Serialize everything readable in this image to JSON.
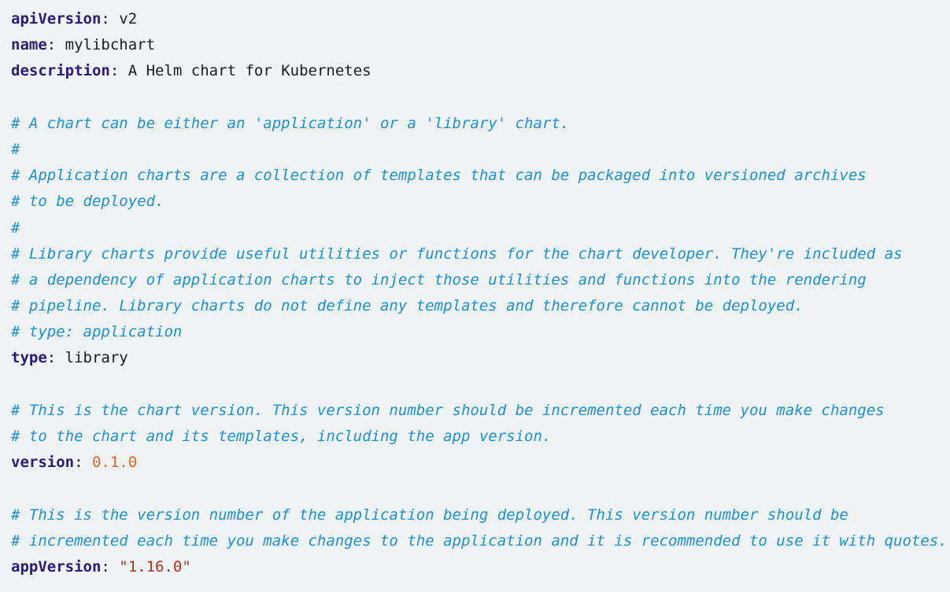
{
  "lines": [
    {
      "kind": "kv",
      "key": "apiVersion",
      "sep": ": ",
      "value": "v2",
      "vtype": "plain"
    },
    {
      "kind": "kv",
      "key": "name",
      "sep": ": ",
      "value": "mylibchart",
      "vtype": "plain"
    },
    {
      "kind": "kv",
      "key": "description",
      "sep": ": ",
      "value": "A Helm chart for Kubernetes",
      "vtype": "plain"
    },
    {
      "kind": "blank"
    },
    {
      "kind": "comment",
      "text": "# A chart can be either an 'application' or a 'library' chart."
    },
    {
      "kind": "comment",
      "text": "#"
    },
    {
      "kind": "comment",
      "text": "# Application charts are a collection of templates that can be packaged into versioned archives"
    },
    {
      "kind": "comment",
      "text": "# to be deployed."
    },
    {
      "kind": "comment",
      "text": "#"
    },
    {
      "kind": "comment",
      "text": "# Library charts provide useful utilities or functions for the chart developer. They're included as"
    },
    {
      "kind": "comment",
      "text": "# a dependency of application charts to inject those utilities and functions into the rendering"
    },
    {
      "kind": "comment",
      "text": "# pipeline. Library charts do not define any templates and therefore cannot be deployed."
    },
    {
      "kind": "comment",
      "text": "# type: application"
    },
    {
      "kind": "kv",
      "key": "type",
      "sep": ": ",
      "value": "library",
      "vtype": "plain"
    },
    {
      "kind": "blank"
    },
    {
      "kind": "comment",
      "text": "# This is the chart version. This version number should be incremented each time you make changes"
    },
    {
      "kind": "comment",
      "text": "# to the chart and its templates, including the app version."
    },
    {
      "kind": "kv",
      "key": "version",
      "sep": ": ",
      "value": "0.1.0",
      "vtype": "number"
    },
    {
      "kind": "blank"
    },
    {
      "kind": "comment",
      "text": "# This is the version number of the application being deployed. This version number should be"
    },
    {
      "kind": "comment",
      "text": "# incremented each time you make changes to the application and it is recommended to use it with quotes."
    },
    {
      "kind": "kv",
      "key": "appVersion",
      "sep": ": ",
      "value": "\"1.16.0\"",
      "vtype": "string"
    }
  ],
  "colors": {
    "background": "#f0f3f5",
    "key": "#2a1a7a",
    "comment": "#1b8fe0",
    "number": "#e8661c",
    "string": "#b4321a",
    "text": "#1b1b1b"
  }
}
